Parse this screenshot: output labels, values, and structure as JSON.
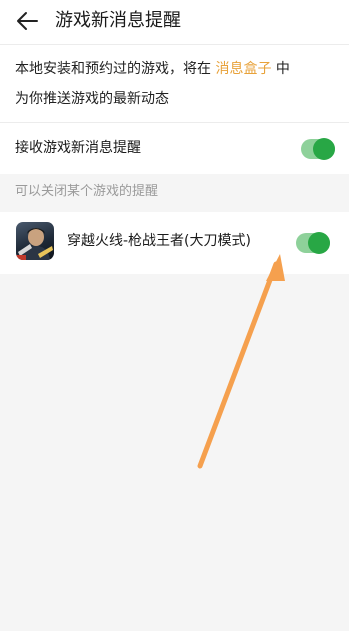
{
  "header": {
    "title": "游戏新消息提醒",
    "back_icon": "arrow-left-icon"
  },
  "intro": {
    "line1_prefix": "本地安装和预约过的游戏，将在",
    "line1_link": "消息盒子",
    "line1_suffix": "中",
    "line2": "为你推送游戏的最新动态",
    "accent_color": "#e8a23a"
  },
  "main_toggle": {
    "label": "接收游戏新消息提醒",
    "on": true
  },
  "section_hint": "可以关闭某个游戏的提醒",
  "games": [
    {
      "title": "穿越火线-枪战王者(大刀模式)",
      "icon": "game-app-icon",
      "on": true
    }
  ],
  "colors": {
    "switch_track": "#8ed19a",
    "switch_knob": "#28a745",
    "annotation_arrow": "#f5a04e"
  }
}
